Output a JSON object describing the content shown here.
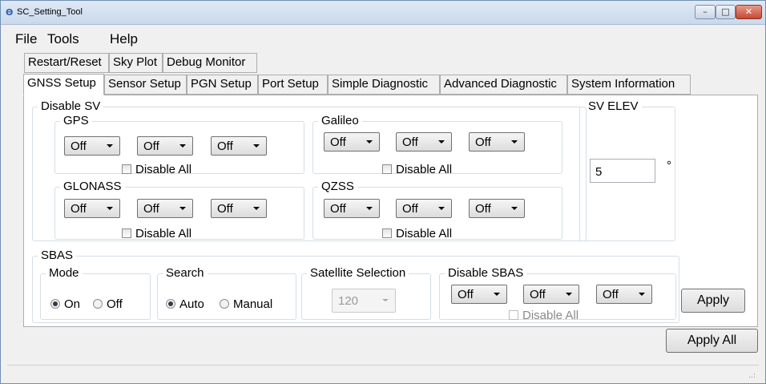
{
  "window": {
    "title": "SC_Setting_Tool",
    "icon_glyph": "Θ",
    "min_glyph": "–",
    "max_glyph": "□",
    "close_glyph": "✕"
  },
  "menu": {
    "file": "File",
    "tools": "Tools",
    "help": "Help"
  },
  "tabs_row1": [
    "Restart/Reset",
    "Sky Plot",
    "Debug Monitor"
  ],
  "tabs_row2": [
    "GNSS Setup",
    "Sensor Setup",
    "PGN Setup",
    "Port Setup",
    "Simple Diagnostic",
    "Advanced Diagnostic",
    "System Information"
  ],
  "active_tab": "GNSS Setup",
  "disable_sv": {
    "label": "Disable SV",
    "gps": {
      "label": "GPS",
      "values": [
        "Off",
        "Off",
        "Off"
      ],
      "disable_all": "Disable All"
    },
    "galileo": {
      "label": "Galileo",
      "values": [
        "Off",
        "Off",
        "Off"
      ],
      "disable_all": "Disable All"
    },
    "glonass": {
      "label": "GLONASS",
      "values": [
        "Off",
        "Off",
        "Off"
      ],
      "disable_all": "Disable All"
    },
    "qzss": {
      "label": "QZSS",
      "values": [
        "Off",
        "Off",
        "Off"
      ],
      "disable_all": "Disable All"
    }
  },
  "sv_elev": {
    "label": "SV ELEV",
    "value": "5",
    "unit": "°"
  },
  "sbas": {
    "label": "SBAS",
    "mode": {
      "label": "Mode",
      "on": "On",
      "off": "Off",
      "selected": "On"
    },
    "search": {
      "label": "Search",
      "auto": "Auto",
      "manual": "Manual",
      "selected": "Auto"
    },
    "satellite_selection": {
      "label": "Satellite Selection",
      "value": "120"
    },
    "disable_sbas": {
      "label": "Disable SBAS",
      "values": [
        "Off",
        "Off",
        "Off"
      ],
      "disable_all": "Disable All"
    }
  },
  "buttons": {
    "apply": "Apply",
    "apply_all": "Apply All"
  },
  "status_bar": {
    "grip": "..:"
  }
}
